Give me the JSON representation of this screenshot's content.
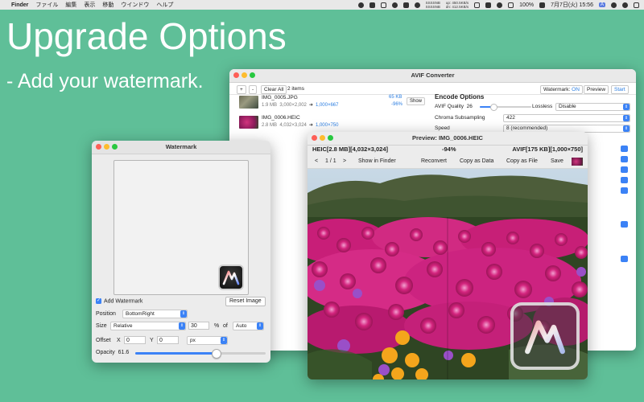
{
  "menubar": {
    "app": "Finder",
    "items": [
      "ファイル",
      "編集",
      "表示",
      "移動",
      "ウインドウ",
      "ヘルプ"
    ],
    "net_up": "up: 450.5KB/s",
    "net_down": "dn: 412.5KB/s",
    "net_label1": "SSSSNB",
    "net_label2": "SSSSNB",
    "battery": "100%",
    "datetime": "7月7日(火)  15:56",
    "input_badge": "A"
  },
  "hero": {
    "title": "Upgrade Options",
    "subtitle": "- Add your watermark."
  },
  "converter": {
    "title": "AVIF Converter",
    "add_label": "+",
    "remove_label": "-",
    "clear_all": "Clear All",
    "item_count": "2 items",
    "watermark_label": "Watermark:",
    "watermark_state": "ON",
    "preview_label": "Preview",
    "start_label": "Start",
    "files": [
      {
        "name": "IMG_0005.JPG",
        "size": "1.9 MB",
        "dims": "3,000×2,002",
        "arrow": "➜",
        "out_dims": "1,000×667",
        "out_size": "65 KB",
        "ratio": "-96%",
        "show": "Show"
      },
      {
        "name": "IMG_0006.HEIC",
        "size": "2.8 MB",
        "dims": "4,032×3,024",
        "arrow": "➜",
        "out_dims": "1,000×750"
      }
    ],
    "encode": {
      "title": "Encode Options",
      "quality_label": "AVIF Quality",
      "quality_value": "26",
      "quality_fraction": 0.26,
      "lossless_label": "Lossless",
      "lossless_value": "Disable",
      "chroma_label": "Chroma Subsampling",
      "chroma_value": "422",
      "speed_label": "Speed",
      "speed_value": "8 (recommended)"
    }
  },
  "watermark": {
    "title": "Watermark",
    "add_label": "Add Watermark",
    "reset_label": "Reset Image",
    "position_label": "Position",
    "position_value": "BottomRight",
    "size_label": "Size",
    "size_mode": "Relative",
    "size_value": "30",
    "size_unit": "%",
    "size_of": "of",
    "size_ref": "Auto",
    "offset_label": "Offset",
    "x_label": "X",
    "x_value": "0",
    "y_label": "Y",
    "y_value": "0",
    "offset_unit": "px",
    "opacity_label": "Opacity",
    "opacity_value": "61.6",
    "opacity_fraction": 0.616
  },
  "preview": {
    "title": "Preview: IMG_0006.HEIC",
    "left_info": "HEIC[2.8 MB][4,032×3,024]",
    "ratio": "-94%",
    "right_info": "AVIF[175 KB][1,000×750]",
    "prev_label": "<",
    "page": "1 / 1",
    "next_label": ">",
    "show_in_finder": "Show in Finder",
    "reconvert": "Reconvert",
    "copy_data": "Copy as Data",
    "copy_file": "Copy as File",
    "save": "Save"
  }
}
